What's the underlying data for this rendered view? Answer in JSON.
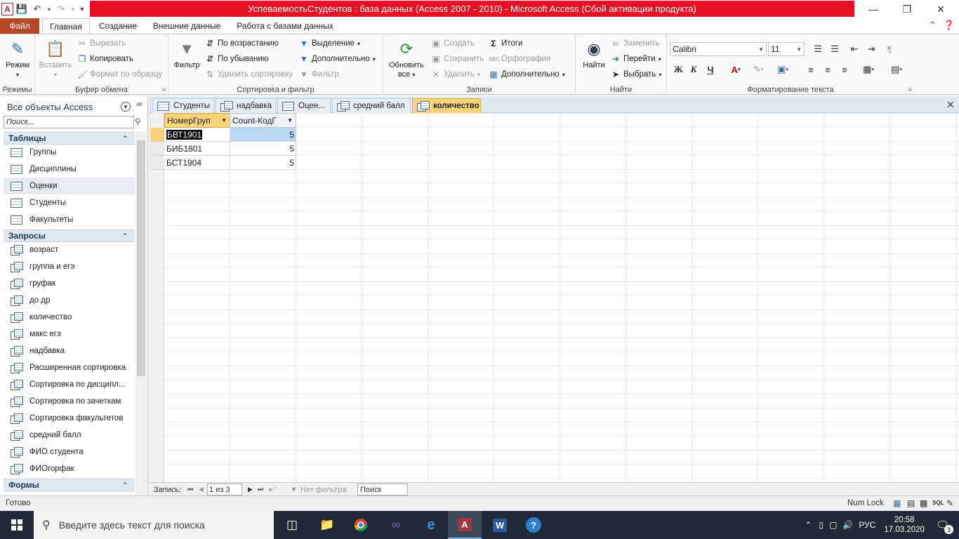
{
  "window": {
    "title": "УспеваемостьСтудентов : база данных (Access 2007 - 2010)  -  Microsoft Access (Сбой активации продукта)"
  },
  "ribbon_tabs": [
    "Файл",
    "Главная",
    "Создание",
    "Внешние данные",
    "Работа с базами данных"
  ],
  "ribbon": {
    "views": {
      "label": "Режим",
      "group": "Режимы"
    },
    "clipboard": {
      "paste": "Вставить",
      "cut": "Вырезать",
      "copy": "Копировать",
      "format_painter": "Формат по образцу",
      "group": "Буфер обмена"
    },
    "sort": {
      "filter": "Фильтр",
      "ascending": "По возрастанию",
      "descending": "По убыванию",
      "remove_sort": "Удалить сортировку",
      "selection": "Выделение",
      "advanced": "Дополнительно",
      "toggle_filter": "Фильтр",
      "group": "Сортировка и фильтр"
    },
    "records": {
      "refresh": "Обновить",
      "refresh2": "все",
      "new": "Создать",
      "save": "Сохранить",
      "delete": "Удалить",
      "totals": "Итоги",
      "spelling": "Орфография",
      "more": "Дополнительно",
      "group": "Записи"
    },
    "find": {
      "find": "Найти",
      "replace": "Заменить",
      "goto": "Перейти",
      "select": "Выбрать",
      "group": "Найти"
    },
    "text": {
      "font": "Calibri",
      "size": "11",
      "bold": "Ж",
      "italic": "К",
      "underline": "Ч",
      "group": "Форматирование текста"
    }
  },
  "nav": {
    "header": "Все объекты Access",
    "search_placeholder": "Поиск...",
    "sections": [
      {
        "title": "Таблицы",
        "items": [
          "Группы",
          "Дисциплины",
          "Оценки",
          "Студенты",
          "Факультеты"
        ]
      },
      {
        "title": "Запросы",
        "items": [
          "возраст",
          "группа и егэ",
          "груфак",
          "до др",
          "количество",
          "макс егэ",
          "надбавка",
          "Расширенная сортировка",
          "Сортировка по дисципл...",
          "Сортировка по зачеткам",
          "Сортировка факультетов",
          "средний балл",
          "ФИО студента",
          "ФИОгорфак"
        ]
      },
      {
        "title": "Формы",
        "items": []
      }
    ]
  },
  "doc_tabs": [
    {
      "label": "Студенты",
      "kind": "table"
    },
    {
      "label": "надбавка",
      "kind": "query"
    },
    {
      "label": "Оцен...",
      "kind": "table"
    },
    {
      "label": "средний балл",
      "kind": "query"
    },
    {
      "label": "количество",
      "kind": "query",
      "active": true
    }
  ],
  "datasheet": {
    "columns": [
      "НомерГруп",
      "Count-КодГ"
    ],
    "rows": [
      [
        "БВТ1901",
        "5"
      ],
      [
        "БИБ1801",
        "5"
      ],
      [
        "БСТ1904",
        "5"
      ]
    ]
  },
  "record_nav": {
    "label": "Запись:",
    "position": "1 из 3",
    "filter": "Нет фильтра",
    "search": "Поиск"
  },
  "status": {
    "left": "Готово",
    "numlock": "Num Lock"
  },
  "taskbar": {
    "search_placeholder": "Введите здесь текст для поиска",
    "lang": "РУС",
    "time": "20:58",
    "date": "17.03.2020",
    "notifications": "3"
  }
}
